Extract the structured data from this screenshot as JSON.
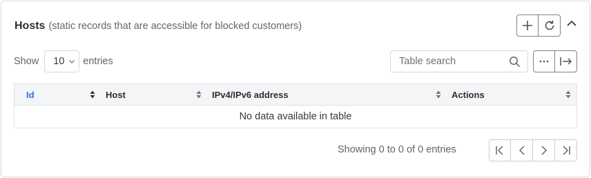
{
  "header": {
    "title": "Hosts",
    "subtitle": "(static records that are accessible for blocked customers)",
    "buttons": [
      {
        "icon": "plus-icon",
        "label": ""
      },
      {
        "icon": "refresh-icon",
        "label": ""
      }
    ],
    "collapse_icon": "chevron-up-icon"
  },
  "length_control": {
    "prefix": "Show",
    "selected": "10",
    "suffix": "entries"
  },
  "search": {
    "placeholder": "Table search",
    "value": ""
  },
  "toolbar": {
    "icons": [
      "more-icon",
      "export-icon"
    ]
  },
  "table": {
    "columns": [
      {
        "label": "Id",
        "sorted": true
      },
      {
        "label": "Host",
        "sorted": false
      },
      {
        "label": "IPv4/IPv6 address",
        "sorted": false
      },
      {
        "label": "Actions",
        "sorted": false
      }
    ],
    "empty_message": "No data available in table"
  },
  "footer": {
    "info": "Showing 0 to 0 of 0 entries",
    "pager_icons": [
      "first-page-icon",
      "prev-page-icon",
      "next-page-icon",
      "last-page-icon"
    ]
  },
  "colors": {
    "accent": "#2f6fdc",
    "header_bg": "#f3f5f7",
    "border": "#d4d7db"
  }
}
